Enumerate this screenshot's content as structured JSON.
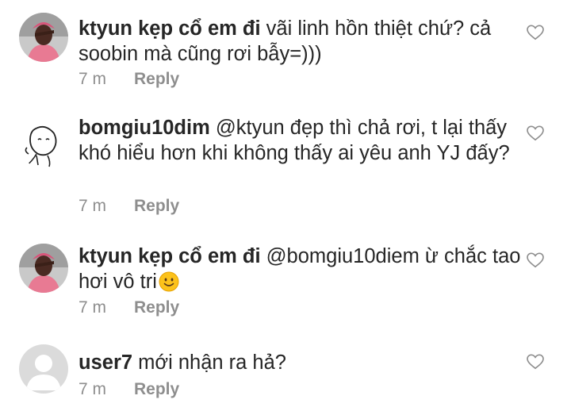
{
  "comments": [
    {
      "username": "ktyun kẹp cổ em đi",
      "text": "vãi linh hồn thiệt chứ? cả soobin mà cũng rơi bẫy=)))",
      "time": "7 m",
      "reply_label": "Reply",
      "avatar_icon": "person-photo-avatar"
    },
    {
      "username": "bomgiu10dim",
      "text": "@ktyun đẹp thì chả rơi, t lại thấy khó hiểu hơn khi không thấy ai yêu anh YJ đấy?",
      "time": "7 m",
      "reply_label": "Reply",
      "avatar_icon": "doodle-face-avatar"
    },
    {
      "username": "ktyun kẹp cổ em đi",
      "text": "@bomgiu10diem ừ chắc tao hơi vô tri",
      "emoji": "smiling-face-emoji",
      "time": "7 m",
      "reply_label": "Reply",
      "avatar_icon": "person-photo-avatar"
    },
    {
      "username": "user7",
      "text": "mới nhận ra hả?",
      "time": "7 m",
      "reply_label": "Reply",
      "avatar_icon": "default-user-avatar"
    }
  ],
  "colors": {
    "text": "#262626",
    "meta": "#8e8e8e",
    "avatar_bg_pink": "#e87a93",
    "default_avatar_bg": "#dbdbdb"
  }
}
